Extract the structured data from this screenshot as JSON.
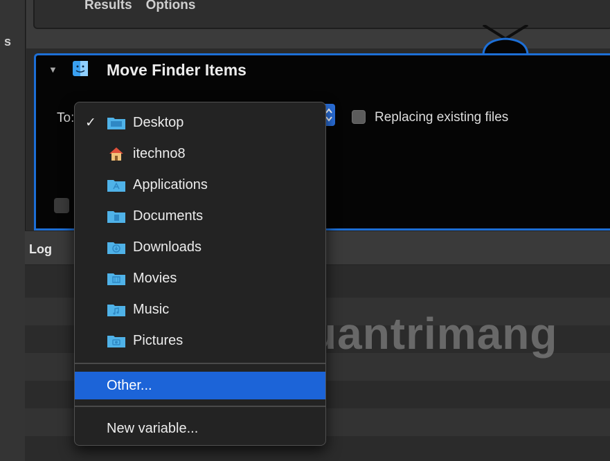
{
  "window": {
    "left_edge_letter": "s"
  },
  "upper_action": {
    "tab_labels": [
      "Results",
      "Options"
    ]
  },
  "action": {
    "title": "Move Finder Items",
    "icon": "finder-icon",
    "to_label": "To:",
    "replace_label": "Replacing existing files",
    "replace_checked": false
  },
  "log": {
    "label": "Log"
  },
  "menu": {
    "selected_index": 0,
    "locations": [
      {
        "label": "Desktop",
        "icon": "desktop-folder-icon",
        "checked": true
      },
      {
        "label": "itechno8",
        "icon": "home-icon",
        "checked": false
      },
      {
        "label": "Applications",
        "icon": "applications-folder-icon",
        "checked": false
      },
      {
        "label": "Documents",
        "icon": "documents-folder-icon",
        "checked": false
      },
      {
        "label": "Downloads",
        "icon": "downloads-folder-icon",
        "checked": false
      },
      {
        "label": "Movies",
        "icon": "movies-folder-icon",
        "checked": false
      },
      {
        "label": "Music",
        "icon": "music-folder-icon",
        "checked": false
      },
      {
        "label": "Pictures",
        "icon": "pictures-folder-icon",
        "checked": false
      }
    ],
    "other_label": "Other...",
    "new_variable_label": "New variable...",
    "highlighted": "Other..."
  },
  "watermark": {
    "text": "uantrimang"
  },
  "colors": {
    "accent": "#1c64d8",
    "folder": "#4fb2e8",
    "menu_bg": "#232323"
  }
}
